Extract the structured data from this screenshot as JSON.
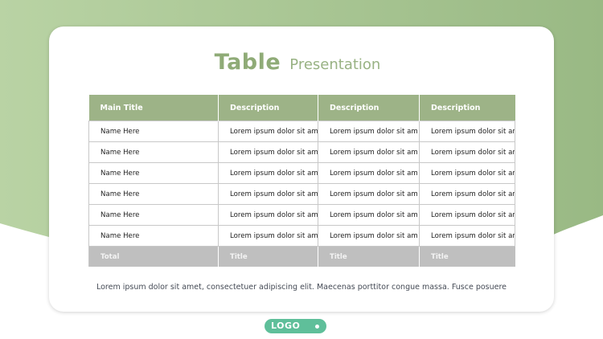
{
  "slide": {
    "title_main": "Table",
    "title_sub": "Presentation"
  },
  "table": {
    "headers": [
      "Main Title",
      "Description",
      "Description",
      "Description"
    ],
    "rows": [
      [
        "Name Here",
        "Lorem ipsum dolor sit am",
        "Lorem ipsum dolor sit am",
        "Lorem ipsum dolor sit am"
      ],
      [
        "Name Here",
        "Lorem ipsum dolor sit am",
        "Lorem ipsum dolor sit am",
        "Lorem ipsum dolor sit am"
      ],
      [
        "Name Here",
        "Lorem ipsum dolor sit am",
        "Lorem ipsum dolor sit am",
        "Lorem ipsum dolor sit am"
      ],
      [
        "Name Here",
        "Lorem ipsum dolor sit am",
        "Lorem ipsum dolor sit am",
        "Lorem ipsum dolor sit am"
      ],
      [
        "Name Here",
        "Lorem ipsum dolor sit am",
        "Lorem ipsum dolor sit am",
        "Lorem ipsum dolor sit am"
      ],
      [
        "Name Here",
        "Lorem ipsum dolor sit am",
        "Lorem ipsum dolor sit am",
        "Lorem ipsum dolor sit am"
      ]
    ],
    "footer": [
      "Total",
      "Title",
      "Title",
      "Title"
    ]
  },
  "caption": "Lorem ipsum dolor sit amet,  consectetuer adipiscing elit. Maecenas porttitor congue massa. Fusce posuere",
  "logo": {
    "label": "LOGO"
  },
  "colors": {
    "accent_green": "#9db387",
    "title_green": "#8fab77",
    "footer_gray": "#bfbfbf",
    "logo_teal": "#5fbf9a"
  }
}
